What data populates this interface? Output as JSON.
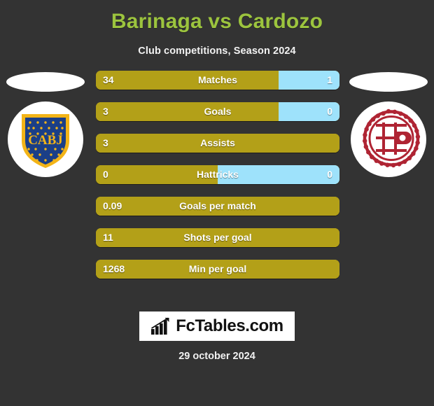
{
  "header": {
    "title": "Barinaga vs Cardozo",
    "subtitle": "Club competitions, Season 2024",
    "title_color": "#9CC43E"
  },
  "teams": {
    "home": {
      "crest_name": "boca-juniors-crest",
      "crest_text": "CABJ"
    },
    "away": {
      "crest_name": "lanus-crest",
      "crest_text": ""
    }
  },
  "colors": {
    "background": "#333333",
    "bar_home": "#B3A018",
    "bar_away": "#9EE2FB",
    "accent_title": "#9CC43E",
    "crest_home_shield": "#1B3F87",
    "crest_home_gold": "#F3B417",
    "crest_away_red": "#AF2433"
  },
  "chart_data": {
    "type": "bar",
    "title": "Barinaga vs Cardozo",
    "subtitle": "Club competitions, Season 2024",
    "orientation": "horizontal-split",
    "categories": [
      "Matches",
      "Goals",
      "Assists",
      "Hattricks",
      "Goals per match",
      "Shots per goal",
      "Min per goal"
    ],
    "series": [
      {
        "name": "Barinaga",
        "values": [
          "34",
          "3",
          "3",
          "0",
          "0.09",
          "11",
          "1268"
        ]
      },
      {
        "name": "Cardozo",
        "values": [
          "1",
          "0",
          "",
          "0",
          "",
          "",
          ""
        ]
      }
    ],
    "home_share_pct": [
      75,
      75,
      100,
      50,
      100,
      100,
      100
    ],
    "legend": []
  },
  "rows": [
    {
      "label": "Matches",
      "home": "34",
      "away": "1",
      "home_pct": 75,
      "has_away": true
    },
    {
      "label": "Goals",
      "home": "3",
      "away": "0",
      "home_pct": 75,
      "has_away": true
    },
    {
      "label": "Assists",
      "home": "3",
      "away": "",
      "home_pct": 100,
      "has_away": false
    },
    {
      "label": "Hattricks",
      "home": "0",
      "away": "0",
      "home_pct": 50,
      "has_away": true
    },
    {
      "label": "Goals per match",
      "home": "0.09",
      "away": "",
      "home_pct": 100,
      "has_away": false
    },
    {
      "label": "Shots per goal",
      "home": "11",
      "away": "",
      "home_pct": 100,
      "has_away": false
    },
    {
      "label": "Min per goal",
      "home": "1268",
      "away": "",
      "home_pct": 100,
      "has_away": false
    }
  ],
  "footer": {
    "brand": "FcTables.com",
    "brand_icon": "bar-chart-growth-icon",
    "date": "29 october 2024"
  }
}
